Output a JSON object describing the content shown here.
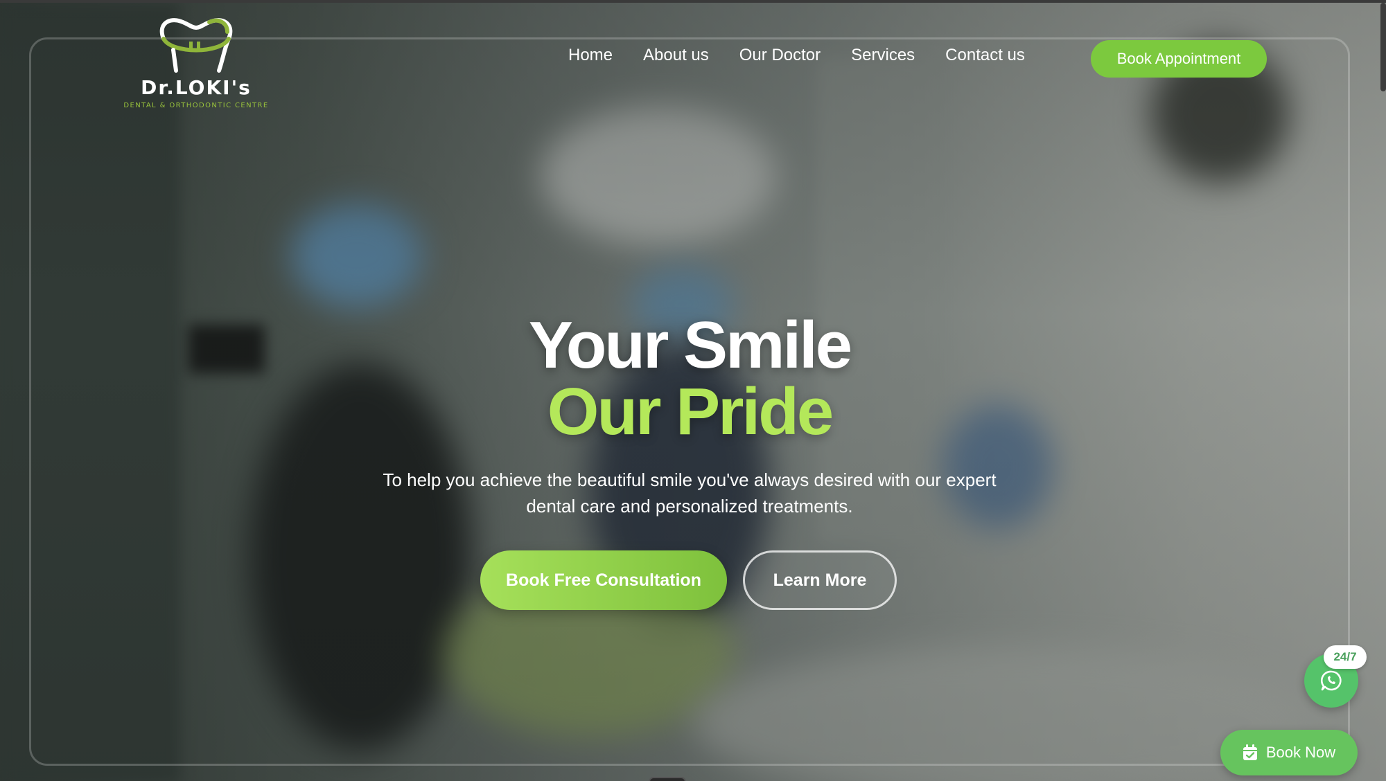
{
  "brand": {
    "name": "Dr.LOKI's",
    "tagline": "DENTAL & ORTHODONTIC CENTRE",
    "accent": "#7cc93e",
    "highlight": "#b4e85a"
  },
  "nav": {
    "items": [
      {
        "label": "Home"
      },
      {
        "label": "About us"
      },
      {
        "label": "Our Doctor"
      },
      {
        "label": "Services"
      },
      {
        "label": "Contact us"
      }
    ],
    "cta_label": "Book Appointment"
  },
  "hero": {
    "title_line1": "Your Smile",
    "title_line2": "Our Pride",
    "subtitle": "To help you achieve the beautiful smile you've always desired with our expert dental care and personalized treatments.",
    "primary_button": "Book Free Consultation",
    "secondary_button": "Learn More"
  },
  "widgets": {
    "whatsapp_badge": "24/7",
    "whatsapp_icon": "whatsapp-icon",
    "book_now_label": "Book Now",
    "book_now_icon": "calendar-check-icon"
  }
}
